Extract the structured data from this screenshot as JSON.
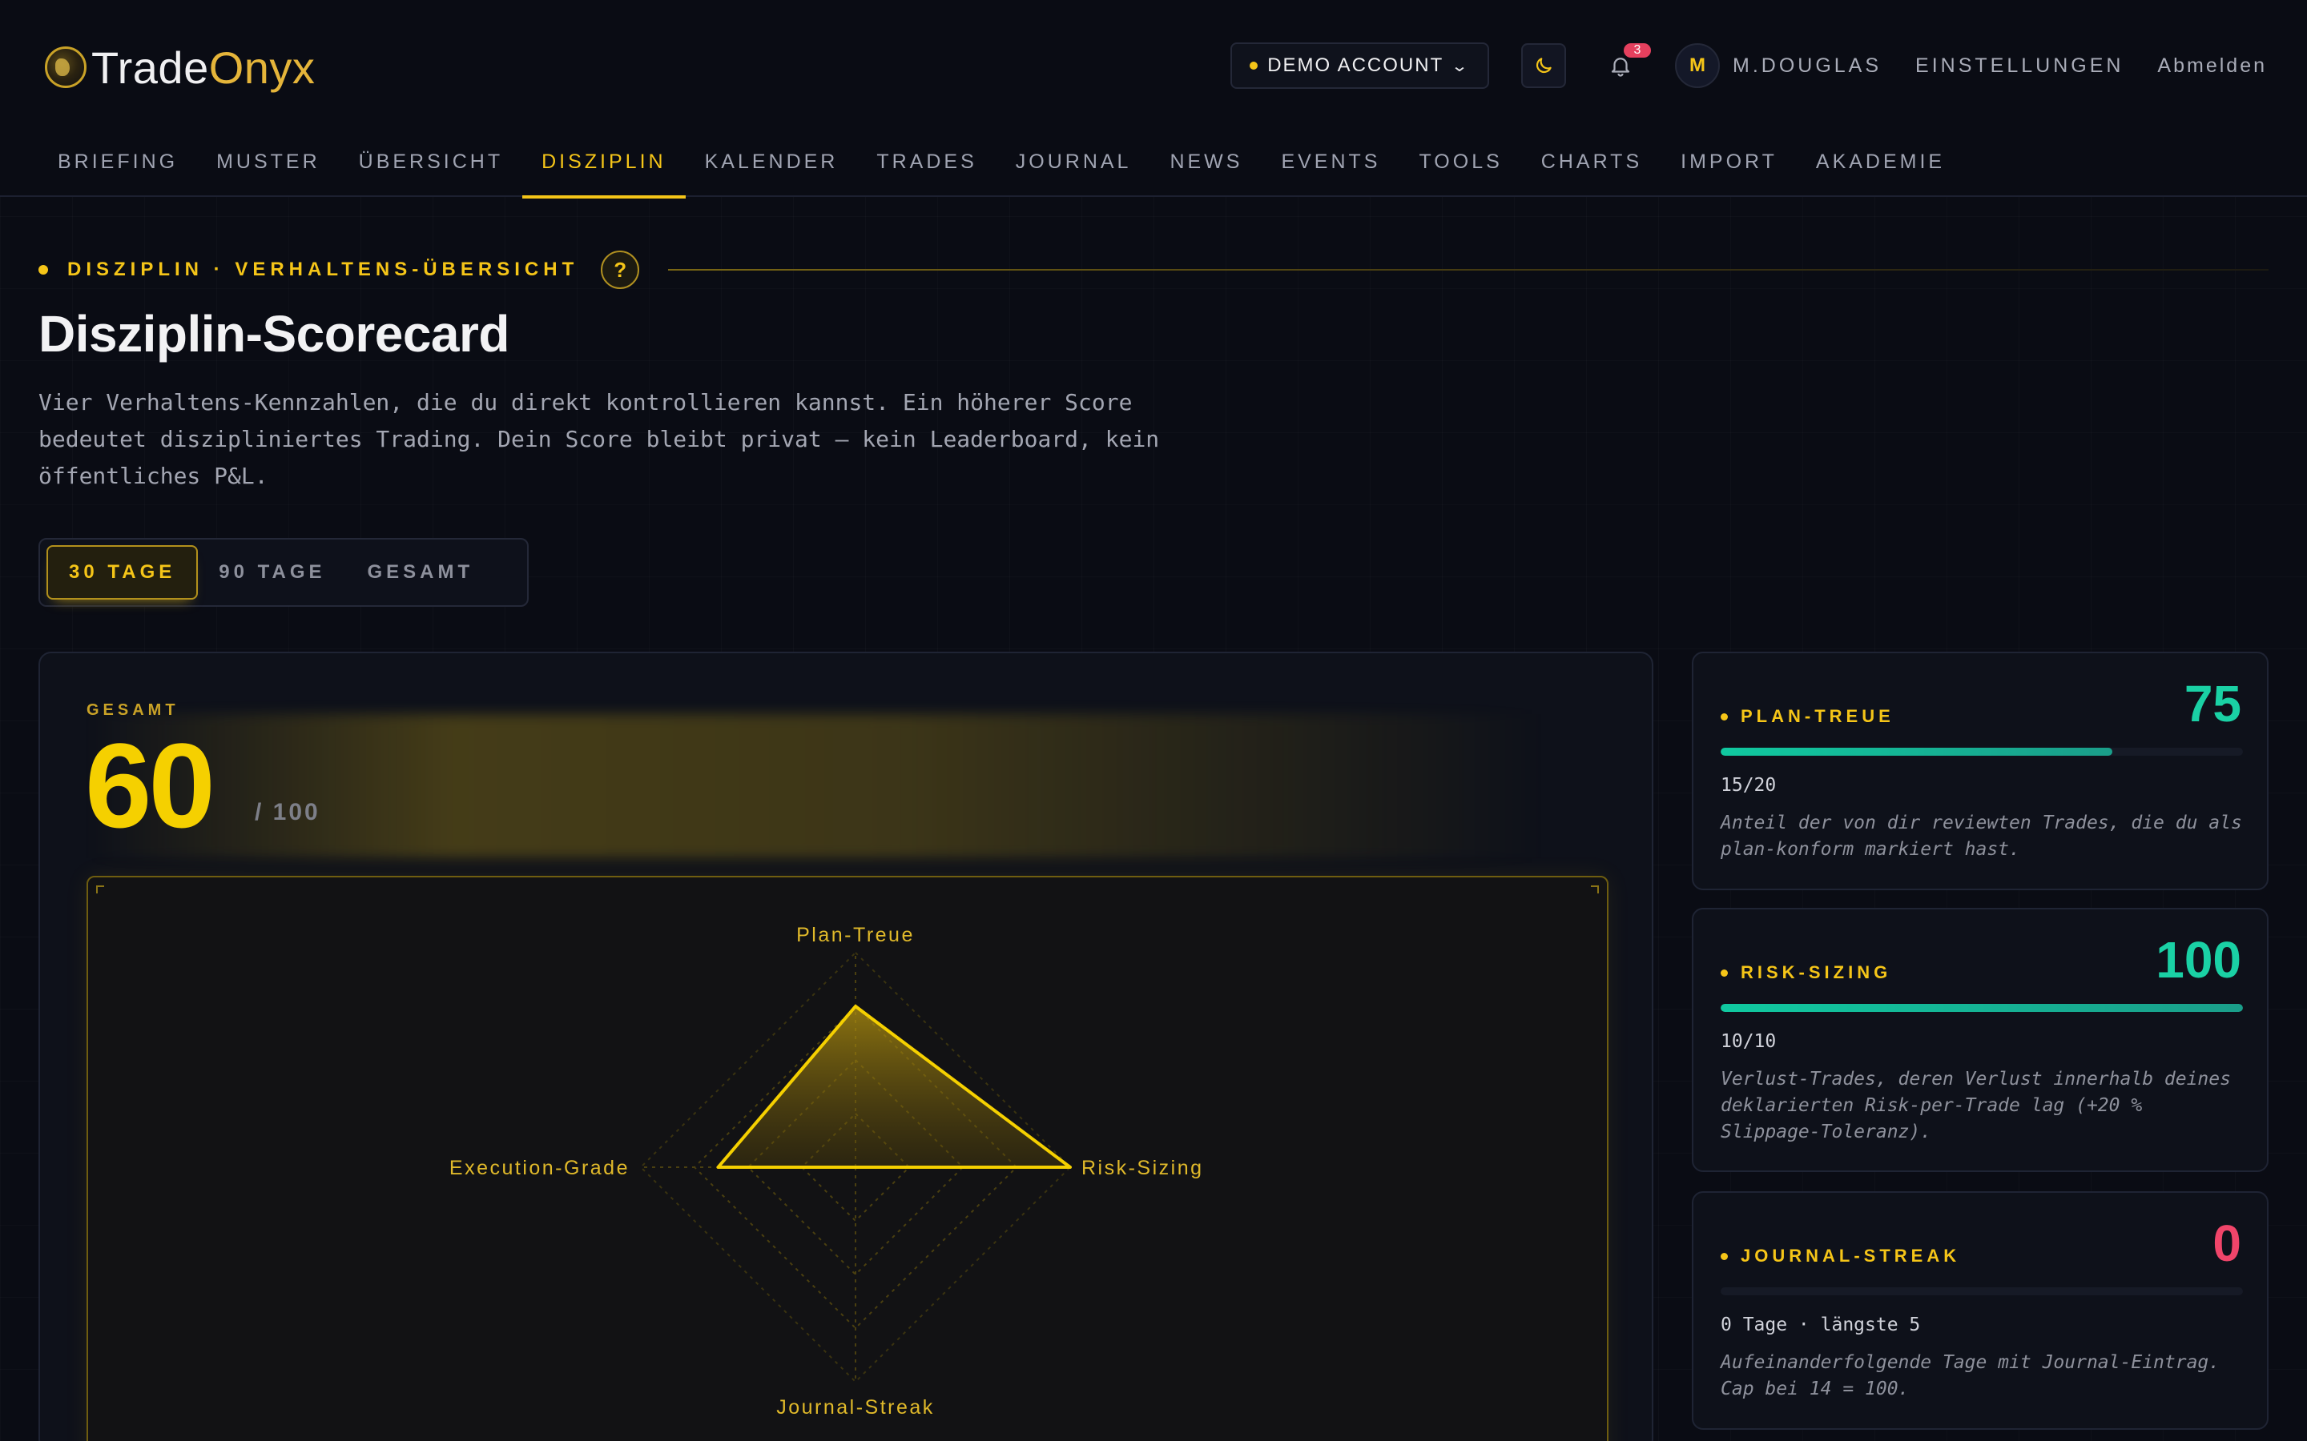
{
  "app": {
    "logo_part1": "Trade",
    "logo_part2": "Onyx"
  },
  "header": {
    "account_label": "DEMO ACCOUNT",
    "notification_count": "3",
    "avatar_initial": "M",
    "username": "M.DOUGLAS",
    "settings_label": "EINSTELLUNGEN",
    "logout_label": "Abmelden"
  },
  "nav": {
    "items": [
      {
        "label": "BRIEFING"
      },
      {
        "label": "MUSTER"
      },
      {
        "label": "ÜBERSICHT"
      },
      {
        "label": "DISZIPLIN"
      },
      {
        "label": "KALENDER"
      },
      {
        "label": "TRADES"
      },
      {
        "label": "JOURNAL"
      },
      {
        "label": "NEWS"
      },
      {
        "label": "EVENTS"
      },
      {
        "label": "TOOLS"
      },
      {
        "label": "CHARTS"
      },
      {
        "label": "IMPORT"
      },
      {
        "label": "AKADEMIE"
      }
    ],
    "active": "DISZIPLIN"
  },
  "intro": {
    "eyebrow": "DISZIPLIN · VERHALTENS-ÜBERSICHT",
    "help_label": "?",
    "title": "Disziplin-Scorecard",
    "description": "Vier Verhaltens-Kennzahlen, die du direkt kontrollieren kannst. Ein höherer Score bedeutet diszipliniertes Trading. Dein Score bleibt privat — kein Leaderboard, kein öffentliches P&L."
  },
  "period": {
    "options": [
      "30 TAGE",
      "90 TAGE",
      "GESAMT"
    ],
    "selected": "30 TAGE"
  },
  "total": {
    "label": "GESAMT",
    "score": "60",
    "max": "/ 100"
  },
  "chart_data": {
    "type": "radar",
    "axes": [
      "Plan-Treue",
      "Risk-Sizing",
      "Journal-Streak",
      "Execution-Grade"
    ],
    "values": [
      75,
      100,
      0,
      64
    ],
    "range": [
      0,
      100
    ],
    "grid_levels": 4,
    "accent_color": "#f5d000"
  },
  "metrics": [
    {
      "title": "PLAN-TREUE",
      "score": "75",
      "progress": 0.75,
      "fraction": "15/20",
      "description": "Anteil der von dir reviewten Trades, die du als plan-konform markiert hast.",
      "score_color": "#1ad1a5"
    },
    {
      "title": "RISK-SIZING",
      "score": "100",
      "progress": 1.0,
      "fraction": "10/10",
      "description": "Verlust-Trades, deren Verlust innerhalb deines deklarierten Risk-per-Trade lag (+20 % Slippage-Toleranz).",
      "score_color": "#1ad1a5"
    },
    {
      "title": "JOURNAL-STREAK",
      "score": "0",
      "progress": 0.0,
      "fraction": "0 Tage · längste 5",
      "description": "Aufeinanderfolgende Tage mit Journal-Eintrag. Cap bei 14 = 100.",
      "score_color": "#f0456a"
    }
  ]
}
